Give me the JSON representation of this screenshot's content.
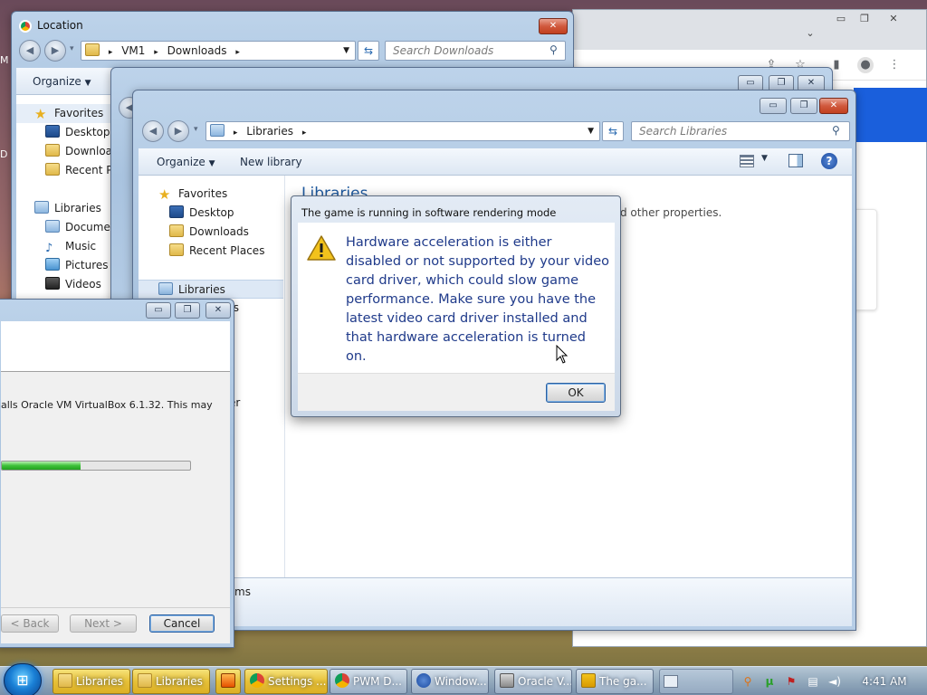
{
  "desktop": {
    "edge_letters": [
      "M",
      "D"
    ]
  },
  "chrome_window": {
    "caption_min": "▭",
    "caption_max": "❐",
    "caption_close": "✕",
    "dropdown": "⌄"
  },
  "location_window": {
    "title": "Location",
    "breadcrumb": [
      "VM1",
      "Downloads"
    ],
    "search_placeholder": "Search Downloads",
    "organize_label": "Organize",
    "favorites_label": "Favorites",
    "nav_items": [
      "Desktop",
      "Downloads",
      "Recent Places"
    ],
    "libraries_label": "Libraries",
    "library_items": [
      "Documents",
      "Music",
      "Pictures",
      "Videos"
    ]
  },
  "middle_window": {},
  "libraries_window": {
    "breadcrumb": [
      "Libraries"
    ],
    "search_placeholder": "Search Libraries",
    "organize_label": "Organize",
    "new_library_label": "New library",
    "favorites_label": "Favorites",
    "nav_items": [
      "Desktop",
      "Downloads",
      "Recent Places"
    ],
    "libraries_label": "Libraries",
    "content_heading": "Libraries",
    "content_subtext_fragment": "d other properties.",
    "partial_nav_fragment_1": "ts",
    "partial_nav_fragment_2": "er",
    "status_fragment": "ms"
  },
  "installer": {
    "description": "alls Oracle VM VirtualBox 6.1.32. This may",
    "progress_fraction": 0.42,
    "back_label": "< Back",
    "next_label": "Next >",
    "cancel_label": "Cancel"
  },
  "dialog": {
    "title": "The game is running in software rendering mode",
    "message": "Hardware acceleration is either disabled or not supported by your video card driver, which could slow game performance. Make sure you have the latest video card driver installed and that hardware acceleration is turned on.",
    "ok_label": "OK"
  },
  "taskbar": {
    "items": [
      {
        "label": "Libraries",
        "icon": "folder-icon",
        "active": true
      },
      {
        "label": "Libraries",
        "icon": "folder-icon",
        "active": true
      },
      {
        "label": "",
        "icon": "media-player-icon",
        "active": true
      },
      {
        "label": "Settings ...",
        "icon": "chrome-icon",
        "active": true
      },
      {
        "label": "PWM D...",
        "icon": "chrome-icon",
        "active": false
      },
      {
        "label": "Window...",
        "icon": "help-icon",
        "active": false
      },
      {
        "label": "Oracle V...",
        "icon": "installer-icon",
        "active": false
      },
      {
        "label": "The ga...",
        "icon": "warning-icon",
        "active": false
      }
    ],
    "clock": "4:41 AM"
  },
  "colors": {
    "dialog_text": "#1f3a8a",
    "progress_green": "#3ec23a",
    "chrome_blue": "#1a5fdc",
    "taskbar_highlight": "#e6c038"
  }
}
